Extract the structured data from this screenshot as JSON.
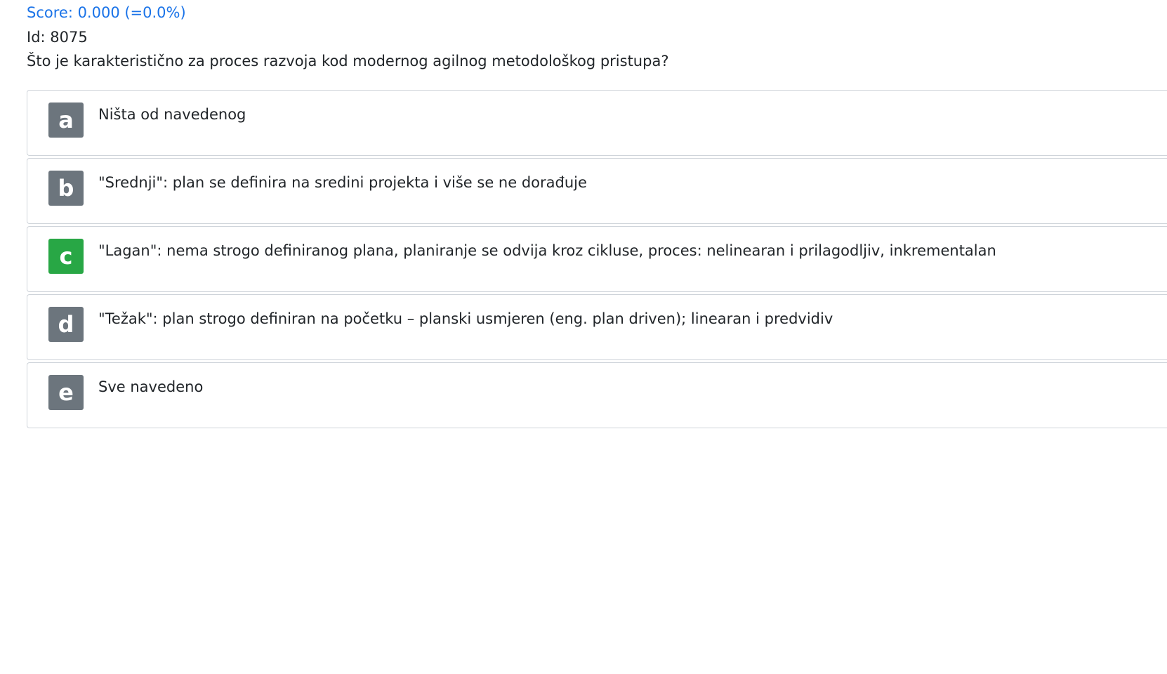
{
  "header": {
    "score": "Score: 0.000 (=0.0%)",
    "id": "Id: 8075",
    "question": "Što je karakteristično za proces razvoja kod modernog agilnog metodološkog pristupa?"
  },
  "options": [
    {
      "letter": "a",
      "text": "Ništa od navedenog",
      "correct": false
    },
    {
      "letter": "b",
      "text": "\"Srednji\": plan se definira na sredini projekta i više se ne dorađuje",
      "correct": false
    },
    {
      "letter": "c",
      "text": "\"Lagan\": nema strogo definiranog plana, planiranje se odvija kroz cikluse, proces: nelinearan i prilagodljiv, inkrementalan",
      "correct": true
    },
    {
      "letter": "d",
      "text": "\"Težak\": plan strogo definiran na početku – planski usmjeren (eng. plan driven); linearan i predvidiv",
      "correct": false
    },
    {
      "letter": "e",
      "text": "Sve navedeno",
      "correct": false
    }
  ],
  "colors": {
    "link": "#1a73e8",
    "badge_default": "#6c757d",
    "badge_correct": "#28a745",
    "border": "#cfd4da"
  }
}
